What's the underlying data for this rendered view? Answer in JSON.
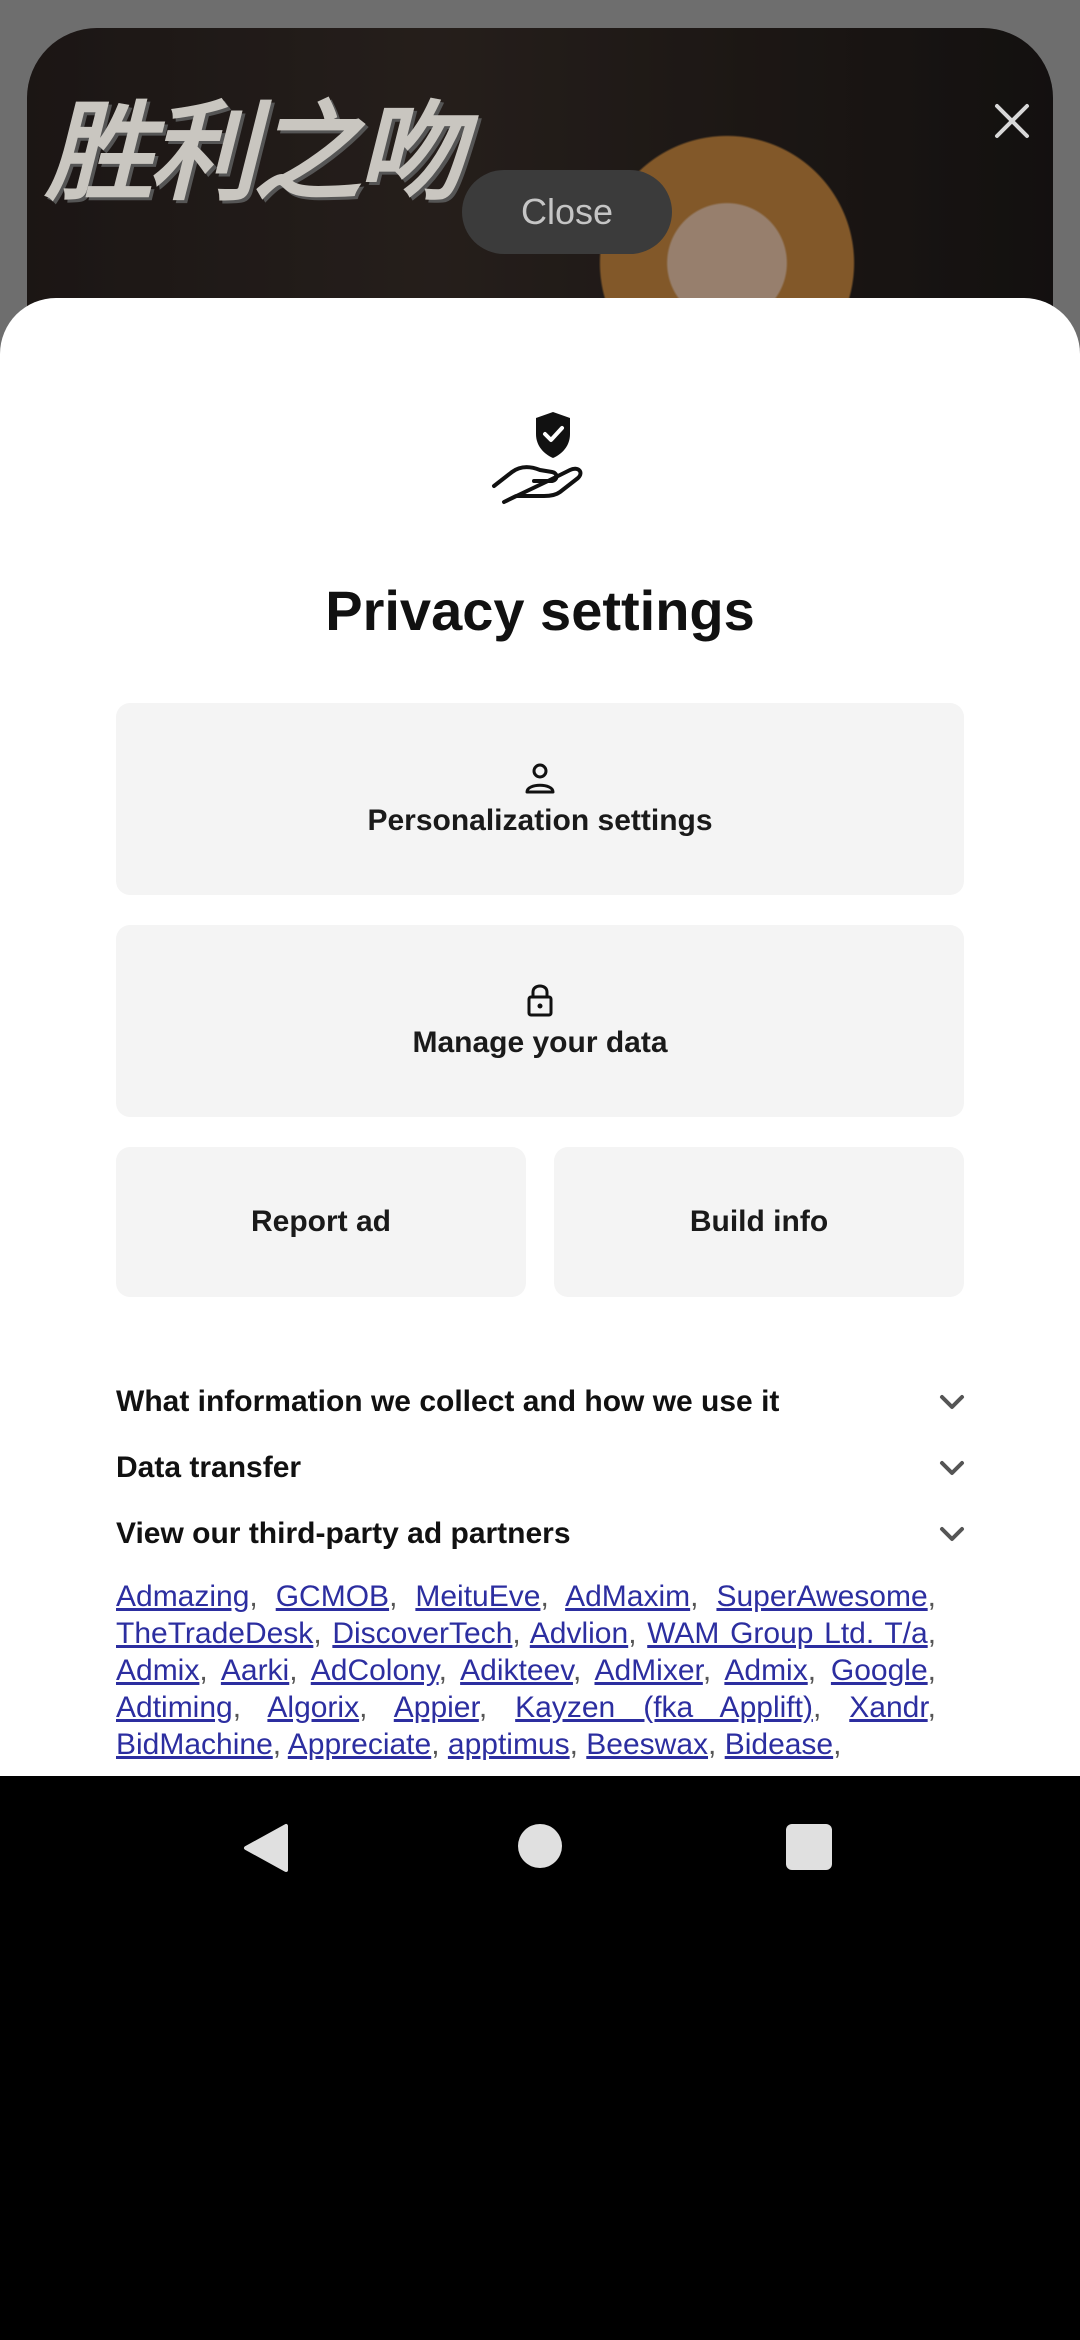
{
  "ad": {
    "logo_text": "胜利之吻",
    "close_label": "Close",
    "close_icon": "close-x-icon"
  },
  "sheet": {
    "hero_icon": "privacy-shield-hand-icon",
    "title": "Privacy settings",
    "tiles": {
      "personalization": {
        "label": "Personalization settings",
        "icon": "person-icon"
      },
      "manage_data": {
        "label": "Manage your data",
        "icon": "lock-icon"
      },
      "report_ad": {
        "label": "Report ad"
      },
      "build_info": {
        "label": "Build info"
      }
    },
    "accordions": [
      {
        "label": "What information we collect and how we use it"
      },
      {
        "label": "Data transfer"
      },
      {
        "label": "View our third-party ad partners"
      }
    ],
    "partners": [
      "Admazing",
      "GCMOB",
      "MeituEve",
      "AdMaxim",
      "SuperAwesome",
      "TheTradeDesk",
      "DiscoverTech",
      "Advlion",
      "WAM Group Ltd. T/a",
      "Admix",
      "Aarki",
      "AdColony",
      "Adikteev",
      "AdMixer",
      "Admix",
      "Google",
      "Adtiming",
      "Algorix",
      "Appier",
      "Kayzen (fka Applift)",
      "Xandr",
      "BidMachine",
      "Appreciate",
      "apptimus",
      "Beeswax",
      "Bidease"
    ]
  },
  "colors": {
    "link": "#2c2ea0",
    "tile_bg": "#f4f4f4",
    "sheet_bg": "#ffffff"
  }
}
